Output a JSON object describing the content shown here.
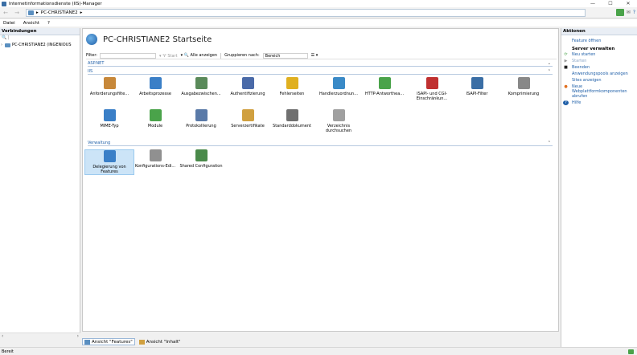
{
  "window": {
    "title": "Internetinformationsdienste (IIS)-Manager",
    "controls": [
      "—",
      "☐",
      "✕"
    ]
  },
  "address": {
    "back": "←",
    "forward": "→",
    "crumbs": [
      "▸",
      "PC-CHRISTIANE2",
      "▸"
    ],
    "right_icons": [
      "✉",
      "?"
    ]
  },
  "menu": [
    "Datei",
    "Ansicht",
    "?"
  ],
  "connections": {
    "header": "Verbindungen",
    "toolbar": "🔍 |",
    "tree": [
      {
        "expander": "›",
        "label": "PC-CHRISTIANE2 (INGENIOUS"
      }
    ],
    "scroll_left": "‹",
    "scroll_right": "›"
  },
  "main": {
    "title": "PC-CHRISTIANE2 Startseite",
    "filter": {
      "label": "Filter:",
      "start": "▾ 🝖 Start",
      "show_all": "▾ 🔍 Alle anzeigen",
      "group_by": "Gruppieren nach:",
      "group_value": "Bereich",
      "view": "☰ ▾"
    },
    "groups": [
      {
        "name": "ASP.NET",
        "chev": "⌄"
      },
      {
        "name": "IIS",
        "chev": "⌃"
      },
      {
        "name": "Verwaltung",
        "chev": "⌃"
      }
    ],
    "iis_items": [
      {
        "label": "Anforderungsfilte...",
        "color": "#c7883a"
      },
      {
        "label": "Arbeitsprozesse",
        "color": "#3a7fc7"
      },
      {
        "label": "Ausgabezwischen...",
        "color": "#5a8a5a"
      },
      {
        "label": "Authentifizierung",
        "color": "#4a6aa8"
      },
      {
        "label": "Fehlerseiten",
        "color": "#e0b020"
      },
      {
        "label": "Handlerzuordnun...",
        "color": "#3a8ac7"
      },
      {
        "label": "HTTP-Antworthea...",
        "color": "#4aa34a"
      },
      {
        "label": "ISAPI- und CGI-Einschränkun...",
        "color": "#c03030"
      },
      {
        "label": "ISAPI-Filter",
        "color": "#3a6ea5"
      },
      {
        "label": "Komprimierung",
        "color": "#888888"
      },
      {
        "label": "MIME-Typ",
        "color": "#3a7fc7"
      },
      {
        "label": "Module",
        "color": "#4aa34a"
      },
      {
        "label": "Protokollierung",
        "color": "#5a7aa8"
      },
      {
        "label": "Serverzertifikate",
        "color": "#d0a040"
      },
      {
        "label": "Standarddokument",
        "color": "#707070"
      },
      {
        "label": "Verzeichnis durchsuchen",
        "color": "#a0a0a0"
      }
    ],
    "admin_items": [
      {
        "label": "Delegierung von Features",
        "color": "#3a7fc7"
      },
      {
        "label": "Konfigurations-Edi...",
        "color": "#909090"
      },
      {
        "label": "Shared Configuration",
        "color": "#4a8a4a"
      }
    ],
    "tabs": [
      {
        "label": "Ansicht \"Features\""
      },
      {
        "label": "Ansicht \"Inhalt\""
      }
    ]
  },
  "actions": {
    "header": "Aktionen",
    "items": [
      {
        "icon": "",
        "label": "Feature öffnen",
        "muted": false
      },
      {
        "group": "Server verwalten"
      },
      {
        "icon": "⟳",
        "label": "Neu starten",
        "muted": false
      },
      {
        "icon": "▶",
        "label": "Starten",
        "muted": true
      },
      {
        "icon": "■",
        "label": "Beenden",
        "muted": false
      },
      {
        "icon": "",
        "label": "Anwendungspools anzeigen",
        "muted": false
      },
      {
        "icon": "",
        "label": "Sites anzeigen",
        "muted": false
      },
      {
        "icon": "●",
        "label": "Neue Webplattformkomponenten abrufen",
        "muted": false
      },
      {
        "icon": "?",
        "label": "Hilfe",
        "muted": false
      }
    ]
  },
  "status": {
    "text": "Bereit"
  }
}
